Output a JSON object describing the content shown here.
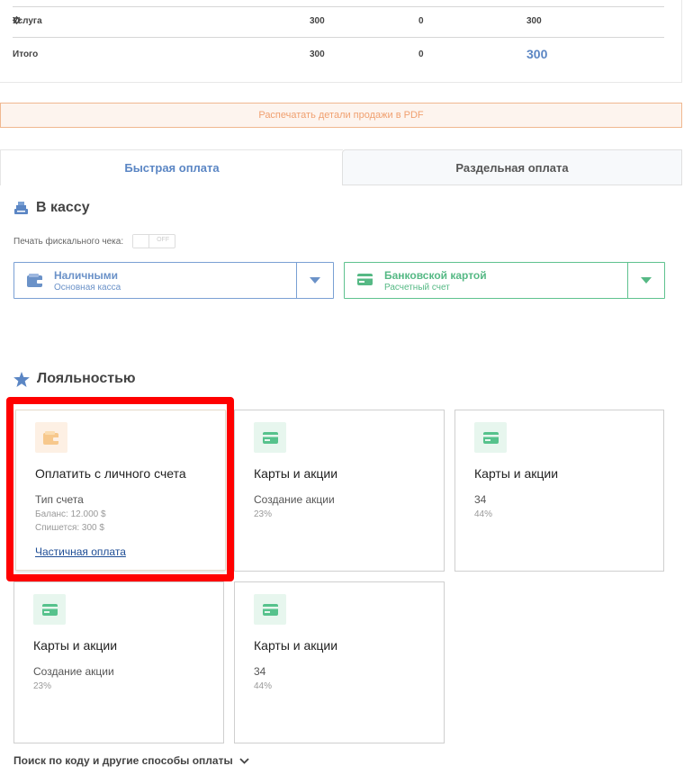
{
  "summary": {
    "rows": [
      {
        "label": "Услуга",
        "col2": "300",
        "col3": "0",
        "col4": "300",
        "icon": "gear-icon"
      },
      {
        "label": "Итого",
        "col2": "300",
        "col3": "0",
        "col4": "300"
      }
    ]
  },
  "pdf_button": "Распечатать детали продажи в PDF",
  "tabs": [
    {
      "label": "Быстрая оплата",
      "active": true
    },
    {
      "label": "Раздельная оплата",
      "active": false
    }
  ],
  "cashier": {
    "title": "В кассу",
    "icon": "cash-register-icon",
    "fiscal_label": "Печать фискального чека:",
    "fiscal_toggle": "OFF",
    "methods": [
      {
        "title": "Наличными",
        "subtitle": "Основная касса",
        "icon": "wallet-icon",
        "color": "#6b92c8"
      },
      {
        "title": "Банковской картой",
        "subtitle": "Расчетный счет",
        "icon": "credit-card-icon",
        "color": "#56b985"
      }
    ]
  },
  "loyalty": {
    "title": "Лояльностью",
    "icon": "star-icon",
    "cards": [
      {
        "title": "Оплатить с личного счета",
        "sub": "Тип счета",
        "line1": "Баланс: 12.000 $",
        "line2": "Спишется: 300 $",
        "link": "Частичная оплата",
        "icon": "wallet-icon",
        "selected": true
      },
      {
        "title": "Карты и акции",
        "sub": "Создание акции",
        "line1": "23%",
        "icon": "credit-card-icon"
      },
      {
        "title": "Карты и акции",
        "sub": "34",
        "line1": "44%",
        "icon": "credit-card-icon"
      },
      {
        "title": "Карты и акции",
        "sub": "Создание акции",
        "line1": "23%",
        "icon": "credit-card-icon"
      },
      {
        "title": "Карты и акции",
        "sub": "34",
        "line1": "44%",
        "icon": "credit-card-icon"
      }
    ]
  },
  "more_options": "Поиск по коду и другие способы оплаты",
  "colors": {
    "accent_blue": "#5b86c4",
    "accent_green": "#56b985",
    "accent_orange": "#f0a070",
    "highlight": "#ff0000"
  }
}
